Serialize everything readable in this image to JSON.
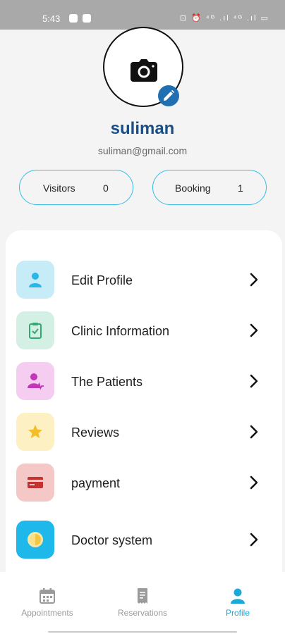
{
  "status_bar": {
    "time": "5:43",
    "right_icons": "⊡ ⏰ ⁴ᴳ .ıl ⁴ᴳ .ıl ▭"
  },
  "profile": {
    "name": "suliman",
    "email": "suliman@gmail.com",
    "stats": [
      {
        "label": "Visitors",
        "value": "0"
      },
      {
        "label": "Booking",
        "value": "1"
      }
    ]
  },
  "menu": {
    "items": [
      {
        "label": "Edit Profile",
        "icon": "person-icon",
        "bg": "#c6ecf8",
        "fg": "#29b6e8"
      },
      {
        "label": "Clinic Information",
        "icon": "clipboard-icon",
        "bg": "#d4f0e4",
        "fg": "#2faa72"
      },
      {
        "label": "The Patients",
        "icon": "patient-icon",
        "bg": "#f5cdf0",
        "fg": "#c237b8"
      },
      {
        "label": "Reviews",
        "icon": "star-icon",
        "bg": "#fdf1c4",
        "fg": "#f2be2a"
      },
      {
        "label": "payment",
        "icon": "card-icon",
        "bg": "#f5c8c8",
        "fg": "#c43131"
      },
      {
        "label": "Doctor system",
        "icon": "sun-icon",
        "bg": "#1fb8ea",
        "fg": "#f6c544"
      }
    ]
  },
  "bottom_nav": {
    "items": [
      {
        "label": "Appointments",
        "icon": "calendar-icon",
        "active": false
      },
      {
        "label": "Reservations",
        "icon": "receipt-icon",
        "active": false
      },
      {
        "label": "Profile",
        "icon": "person-icon",
        "active": true
      }
    ],
    "active_color": "#1da8d8",
    "inactive_color": "#9a9a9a"
  }
}
